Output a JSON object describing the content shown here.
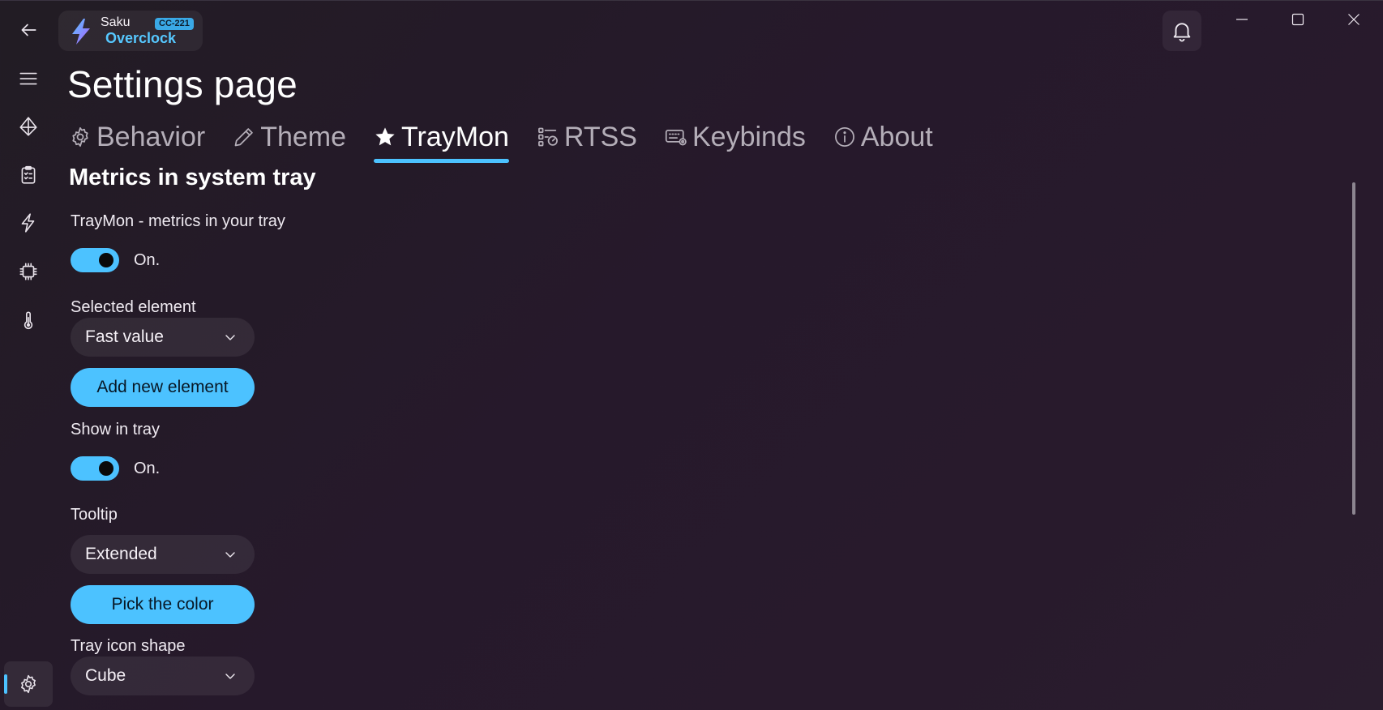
{
  "app": {
    "name_top": "Saku",
    "name_bottom": "Overclock",
    "code_badge": "CC-221",
    "accent_color": "#4cc2ff"
  },
  "titlebar": {
    "bell_icon": "bell-icon",
    "minimize_icon": "minimize-icon",
    "maximize_icon": "maximize-icon",
    "close_icon": "close-icon"
  },
  "rail": {
    "items": [
      {
        "icon": "back-arrow-icon"
      },
      {
        "icon": "hamburger-menu-icon"
      },
      {
        "icon": "diamond-pyramid-icon"
      },
      {
        "icon": "clipboard-checklist-icon"
      },
      {
        "icon": "lightning-icon"
      },
      {
        "icon": "cpu-chip-icon"
      },
      {
        "icon": "thermometer-icon"
      }
    ],
    "footer_icon": "gear-icon"
  },
  "page": {
    "title": "Settings page",
    "tabs": [
      {
        "label": "Behavior",
        "icon": "gear-icon"
      },
      {
        "label": "Theme",
        "icon": "pen-icon"
      },
      {
        "label": "TrayMon",
        "icon": "star-icon",
        "active": true
      },
      {
        "label": "RTSS",
        "icon": "list-gauge-icon"
      },
      {
        "label": "Keybinds",
        "icon": "keyboard-gear-icon"
      },
      {
        "label": "About",
        "icon": "info-icon"
      }
    ]
  },
  "traymon": {
    "section_title": "Metrics in system tray",
    "traymon_label": "TrayMon - metrics in your tray",
    "traymon_state": "On.",
    "selected_element_label": "Selected element",
    "selected_element_value": "Fast value",
    "add_element_button": "Add new element",
    "show_in_tray_label": "Show in tray",
    "show_in_tray_state": "On.",
    "tooltip_label": "Tooltip",
    "tooltip_value": "Extended",
    "pick_color_button": "Pick the color",
    "tray_icon_shape_label": "Tray icon shape",
    "tray_icon_shape_value": "Cube"
  }
}
